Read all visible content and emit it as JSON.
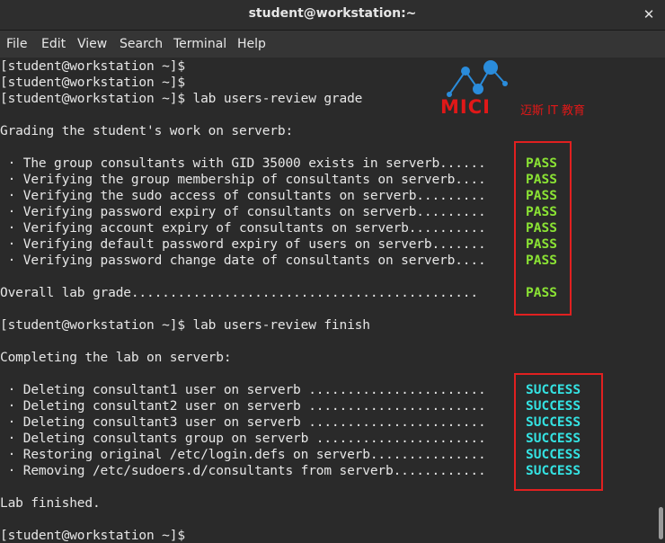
{
  "window": {
    "title": "student@workstation:~",
    "close_glyph": "✕"
  },
  "menu": [
    "File",
    "Edit",
    "View",
    "Search",
    "Terminal",
    "Help"
  ],
  "logo": {
    "text": "MICI",
    "subtext": "迈斯 IT 教育",
    "color": "#e01818"
  },
  "terminal": {
    "lines": [
      "[student@workstation ~]$",
      "[student@workstation ~]$",
      "[student@workstation ~]$ lab users-review grade",
      "",
      "Grading the student's work on serverb:",
      "",
      " · The group consultants with GID 35000 exists in serverb......",
      " · Verifying the group membership of consultants on serverb....",
      " · Verifying the sudo access of consultants on serverb.........",
      " · Verifying password expiry of consultants on serverb.........",
      " · Verifying account expiry of consultants on serverb..........",
      " · Verifying default password expiry of users on serverb.......",
      " · Verifying password change date of consultants on serverb....",
      "",
      "Overall lab grade.............................................",
      "",
      "[student@workstation ~]$ lab users-review finish",
      "",
      "Completing the lab on serverb:",
      "",
      " · Deleting consultant1 user on serverb .......................",
      " · Deleting consultant2 user on serverb .......................",
      " · Deleting consultant3 user on serverb .......................",
      " · Deleting consultants group on serverb ......................",
      " · Restoring original /etc/login.defs on serverb...............",
      " · Removing /etc/sudoers.d/consultants from serverb............",
      "",
      "Lab finished.",
      "",
      "[student@workstation ~]$"
    ],
    "statuses": [
      {
        "line": 6,
        "text": "PASS",
        "kind": "pass"
      },
      {
        "line": 7,
        "text": "PASS",
        "kind": "pass"
      },
      {
        "line": 8,
        "text": "PASS",
        "kind": "pass"
      },
      {
        "line": 9,
        "text": "PASS",
        "kind": "pass"
      },
      {
        "line": 10,
        "text": "PASS",
        "kind": "pass"
      },
      {
        "line": 11,
        "text": "PASS",
        "kind": "pass"
      },
      {
        "line": 12,
        "text": "PASS",
        "kind": "pass"
      },
      {
        "line": 14,
        "text": "PASS",
        "kind": "pass"
      },
      {
        "line": 20,
        "text": "SUCCESS",
        "kind": "success"
      },
      {
        "line": 21,
        "text": "SUCCESS",
        "kind": "success"
      },
      {
        "line": 22,
        "text": "SUCCESS",
        "kind": "success"
      },
      {
        "line": 23,
        "text": "SUCCESS",
        "kind": "success"
      },
      {
        "line": 24,
        "text": "SUCCESS",
        "kind": "success"
      },
      {
        "line": 25,
        "text": "SUCCESS",
        "kind": "success"
      }
    ]
  },
  "colors": {
    "pass": "#8ae234",
    "success": "#34e2e2",
    "highlight_box": "#e02020",
    "terminal_bg": "#2a2a2a"
  }
}
